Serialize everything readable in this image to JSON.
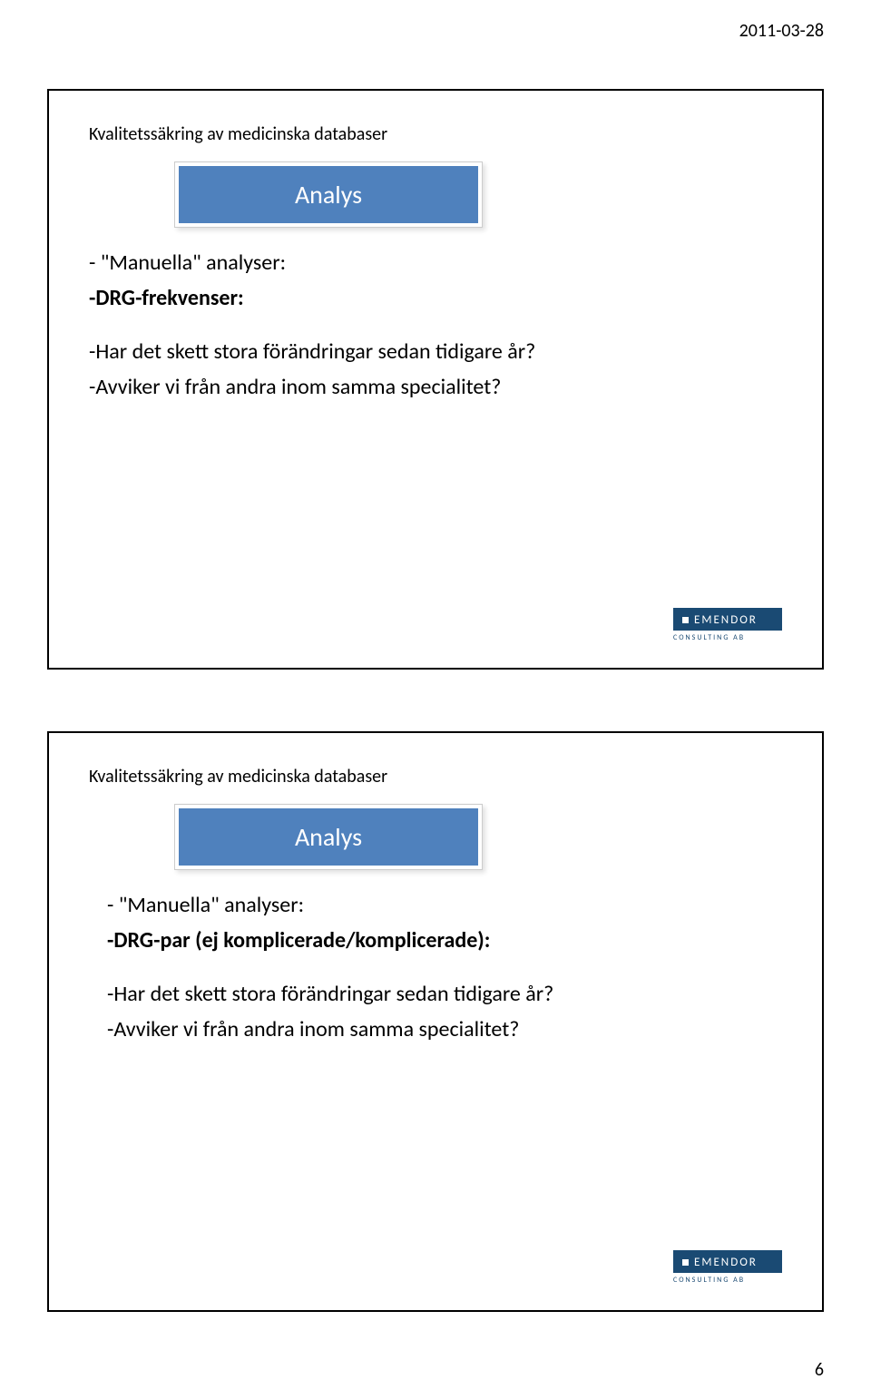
{
  "header": {
    "date": "2011-03-28"
  },
  "footer": {
    "page": "6"
  },
  "logo": {
    "name": "EMENDOR",
    "sub": "CONSULTING AB"
  },
  "slides": [
    {
      "title": "Kvalitetssäkring av medicinska databaser",
      "box": "Analys",
      "lines": [
        {
          "text": "- \"Manuella\" analyser:",
          "bold": false
        },
        {
          "text": "-DRG-frekvenser:",
          "bold": true
        },
        {
          "text": "-Har det skett stora förändringar sedan tidigare år?",
          "bold": false
        },
        {
          "text": "-Avviker vi från andra inom samma specialitet?",
          "bold": false
        }
      ]
    },
    {
      "title": "Kvalitetssäkring av medicinska databaser",
      "box": "Analys",
      "lines": [
        {
          "text": "- \"Manuella\" analyser:",
          "bold": false
        },
        {
          "text": "-DRG-par (ej komplicerade/komplicerade):",
          "bold": true
        },
        {
          "text": "-Har det skett stora förändringar sedan tidigare år?",
          "bold": false
        },
        {
          "text": "-Avviker vi från andra inom samma specialitet?",
          "bold": false
        }
      ]
    }
  ]
}
